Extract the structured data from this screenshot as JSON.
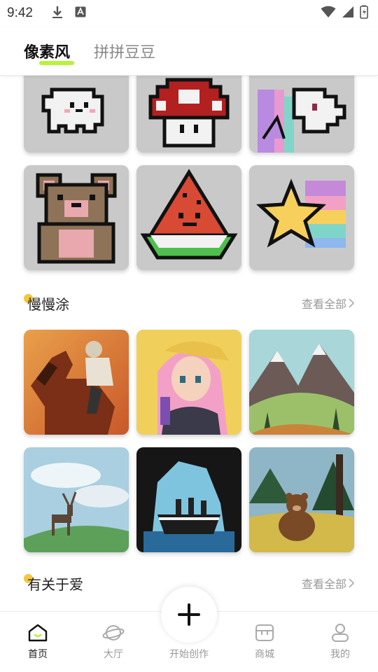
{
  "status_bar": {
    "time": "9:42"
  },
  "top_tabs": [
    {
      "label": "像素风",
      "active": true
    },
    {
      "label": "拼拼豆豆",
      "active": false
    }
  ],
  "pixel_gallery": [
    {
      "subject": "ghost"
    },
    {
      "subject": "mushroom"
    },
    {
      "subject": "unicorn"
    },
    {
      "subject": "bear"
    },
    {
      "subject": "watermelon"
    },
    {
      "subject": "rainbow-star"
    }
  ],
  "sections": [
    {
      "title": "慢慢涂",
      "see_all": "查看全部",
      "items": [
        {
          "subject": "jockey-horse"
        },
        {
          "subject": "anime-girl"
        },
        {
          "subject": "mountains"
        },
        {
          "subject": "deer"
        },
        {
          "subject": "ship"
        },
        {
          "subject": "bear-forest"
        }
      ]
    },
    {
      "title": "有关于爱",
      "see_all": "查看全部"
    }
  ],
  "bottom_nav": [
    {
      "label": "首页",
      "icon": "home-icon",
      "active": true
    },
    {
      "label": "大厅",
      "icon": "planet-icon",
      "active": false
    },
    {
      "label": "开始创作",
      "icon": "plus-icon",
      "active": false
    },
    {
      "label": "商城",
      "icon": "store-icon",
      "active": false
    },
    {
      "label": "我的",
      "icon": "profile-icon",
      "active": false
    }
  ],
  "colors": {
    "accent": "#b9f23a",
    "section_dot": "#f3c73a"
  }
}
